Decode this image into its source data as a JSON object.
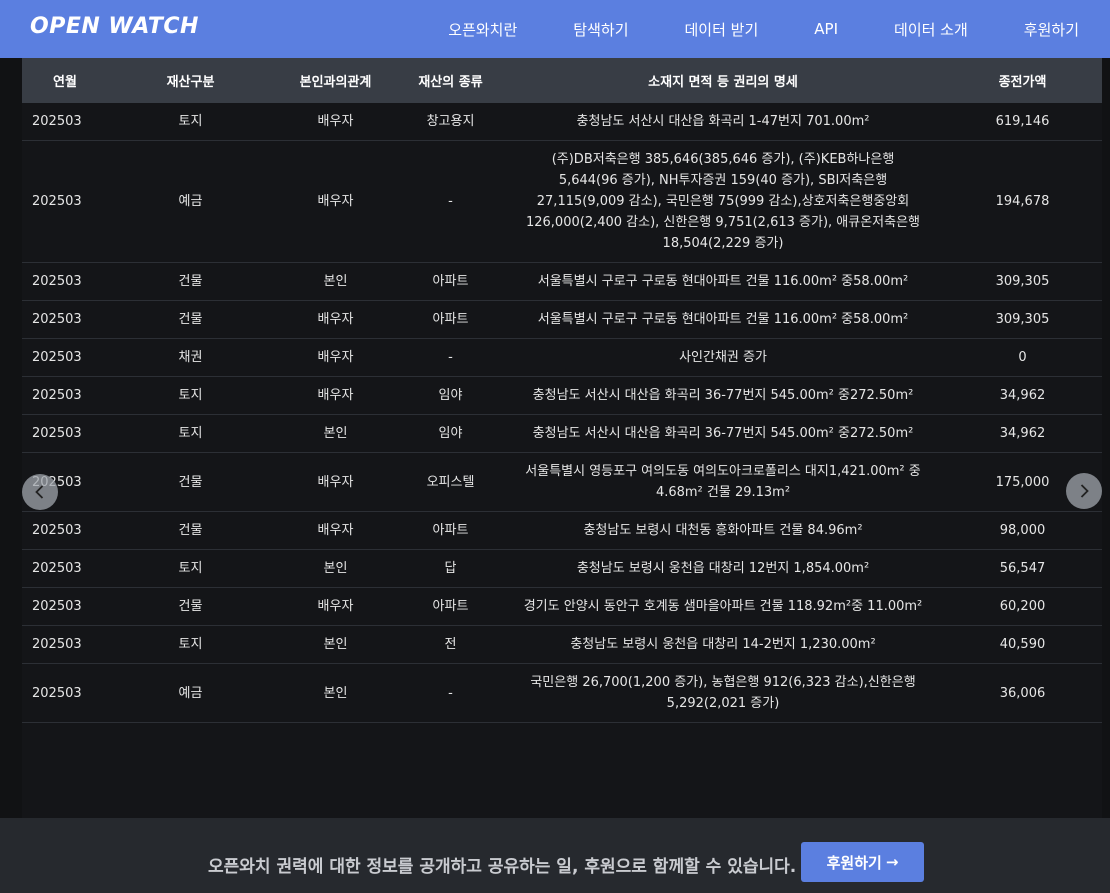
{
  "header": {
    "logo": "OPEN WATCH",
    "nav": [
      "오픈와치란",
      "탐색하기",
      "데이터 받기",
      "API",
      "데이터 소개",
      "후원하기"
    ]
  },
  "table": {
    "columns": [
      "연월",
      "재산구분",
      "본인과의관계",
      "재산의 종류",
      "소재지 면적 등 권리의 명세",
      "종전가액"
    ],
    "rows": [
      [
        "202503",
        "토지",
        "배우자",
        "창고용지",
        "충청남도 서산시 대산읍 화곡리 1-47번지 701.00m²",
        "619,146"
      ],
      [
        "202503",
        "예금",
        "배우자",
        "-",
        "(주)DB저축은행 385,646(385,646 증가), (주)KEB하나은행 5,644(96 증가), NH투자증권 159(40 증가), SBI저축은행27,115(9,009 감소), 국민은행 75(999 감소),상호저축은행중앙회 126,000(2,400 감소), 신한은행 9,751(2,613 증가), 애큐온저축은행 18,504(2,229 증가)",
        "194,678"
      ],
      [
        "202503",
        "건물",
        "본인",
        "아파트",
        "서울특별시 구로구 구로동 현대아파트 건물 116.00m² 중58.00m²",
        "309,305"
      ],
      [
        "202503",
        "건물",
        "배우자",
        "아파트",
        "서울특별시 구로구 구로동 현대아파트 건물 116.00m² 중58.00m²",
        "309,305"
      ],
      [
        "202503",
        "채권",
        "배우자",
        "-",
        "사인간채권 증가",
        "0"
      ],
      [
        "202503",
        "토지",
        "배우자",
        "임야",
        "충청남도 서산시 대산읍 화곡리 36-77번지 545.00m² 중272.50m²",
        "34,962"
      ],
      [
        "202503",
        "토지",
        "본인",
        "임야",
        "충청남도 서산시 대산읍 화곡리 36-77번지 545.00m² 중272.50m²",
        "34,962"
      ],
      [
        "202503",
        "건물",
        "배우자",
        "오피스텔",
        "서울특별시 영등포구 여의도동 여의도아크로폴리스 대지1,421.00m² 중 4.68m² 건물 29.13m²",
        "175,000"
      ],
      [
        "202503",
        "건물",
        "배우자",
        "아파트",
        "충청남도 보령시 대천동 흥화아파트 건물 84.96m²",
        "98,000"
      ],
      [
        "202503",
        "토지",
        "본인",
        "답",
        "충청남도 보령시 웅천읍 대창리 12번지 1,854.00m²",
        "56,547"
      ],
      [
        "202503",
        "건물",
        "배우자",
        "아파트",
        "경기도 안양시 동안구 호계동 샘마을아파트 건물 118.92m²중 11.00m²",
        "60,200"
      ],
      [
        "202503",
        "토지",
        "본인",
        "전",
        "충청남도 보령시 웅천읍 대창리 14-2번지 1,230.00m²",
        "40,590"
      ],
      [
        "202503",
        "예금",
        "본인",
        "-",
        "국민은행 26,700(1,200 증가), 농협은행 912(6,323 감소),신한은행 5,292(2,021 증가)",
        "36,006"
      ]
    ]
  },
  "carousel": {
    "prev_icon": "chevron-left-icon",
    "next_icon": "chevron-right-icon"
  },
  "footer": {
    "text": "오픈와치 권력에 대한 정보를 공개하고 공유하는 일, 후원으로 함께할 수 있습니다.",
    "button_label": "후원하기",
    "button_arrow": "→"
  },
  "colors": {
    "nav_bg": "#5b7fe0",
    "header_row_bg": "#383d45",
    "page_bg": "#111214",
    "footer_bg": "#26292e",
    "button_bg": "#5b7fe0"
  }
}
